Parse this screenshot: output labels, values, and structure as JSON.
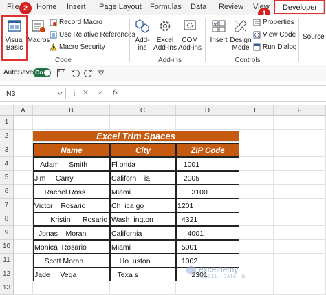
{
  "tabs": [
    "File",
    "Home",
    "Insert",
    "Page Layout",
    "Formulas",
    "Data",
    "Review",
    "View",
    "Developer"
  ],
  "ribbon": {
    "visual_basic": "Visual Basic",
    "macros": "Macros",
    "record_macro": "Record Macro",
    "relative_refs": "Use Relative References",
    "macro_security": "Macro Security",
    "code_group": "Code",
    "addins": "Add-ins",
    "excel_addins": "Excel Add-ins",
    "com_addins": "COM Add-ins",
    "addins_group": "Add-ins",
    "insert": "Insert",
    "design_mode": "Design Mode",
    "properties": "Properties",
    "view_code": "View Code",
    "run_dialog": "Run Dialog",
    "controls_group": "Controls",
    "source": "Source"
  },
  "autosave": {
    "label": "AutoSave",
    "state": "On"
  },
  "formula_bar": {
    "name_box": "N3",
    "fx": "fx"
  },
  "columns": [
    "A",
    "B",
    "C",
    "D",
    "E",
    "F"
  ],
  "rows": [
    "1",
    "2",
    "3",
    "4",
    "5",
    "6",
    "7",
    "8",
    "9",
    "10",
    "11",
    "12",
    "13"
  ],
  "sheet": {
    "title": "Excel Trim Spaces",
    "headers": [
      "Name",
      "City",
      "ZIP Code"
    ],
    "data": [
      [
        "   Adam     Smith",
        "Fl orida",
        "   1001"
      ],
      [
        "Jim     Carry",
        "Californ    ia",
        "   2005"
      ],
      [
        "     Rachel Ross",
        "Miami",
        "       3100"
      ],
      [
        "Victor    Rosario",
        "Ch  ica go",
        "1201"
      ],
      [
        "        Kristin      Rosario",
        "Wash  ington",
        "  4321"
      ],
      [
        "  Jonas    Moran",
        "California",
        "     4001"
      ],
      [
        "Monica  Rosario",
        "Miami",
        "  5001"
      ],
      [
        "     Scott Moran",
        "    Ho  uston",
        "  1002"
      ],
      [
        "Jade     Vega",
        "   Texa s",
        "       2301"
      ]
    ]
  },
  "badges": [
    "1",
    "2"
  ],
  "watermark": "exceldemy",
  "watermark_sub": "EXCEL · DATA · BI",
  "colors": {
    "accent": "#c55a11",
    "highlight": "#e03030",
    "toggle": "#217346"
  }
}
